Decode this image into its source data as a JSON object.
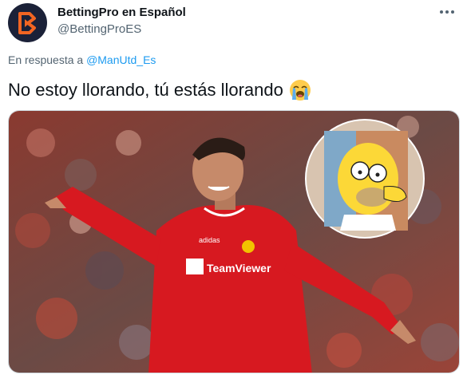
{
  "author": {
    "name": "BettingPro en Español",
    "handle": "@BettingProES"
  },
  "reply": {
    "prefix": "En respuesta a",
    "mention": "@ManUtd_Es"
  },
  "tweet": {
    "text": "No estoy llorando, tú estás llorando",
    "emoji": "crying-face"
  },
  "media": {
    "shirt_text": "TeamViewer",
    "kit_brand": "adidas",
    "subject": "football player in red jersey pointing, inset of cartoon character crying"
  },
  "colors": {
    "brand_orange": "#f26522",
    "avatar_bg": "#1b2138",
    "link_blue": "#1d9bf0",
    "jersey_red": "#d71920"
  },
  "icons": [
    "bettingpro-logo-icon",
    "more-options-icon",
    "loudly-crying-face-icon"
  ]
}
